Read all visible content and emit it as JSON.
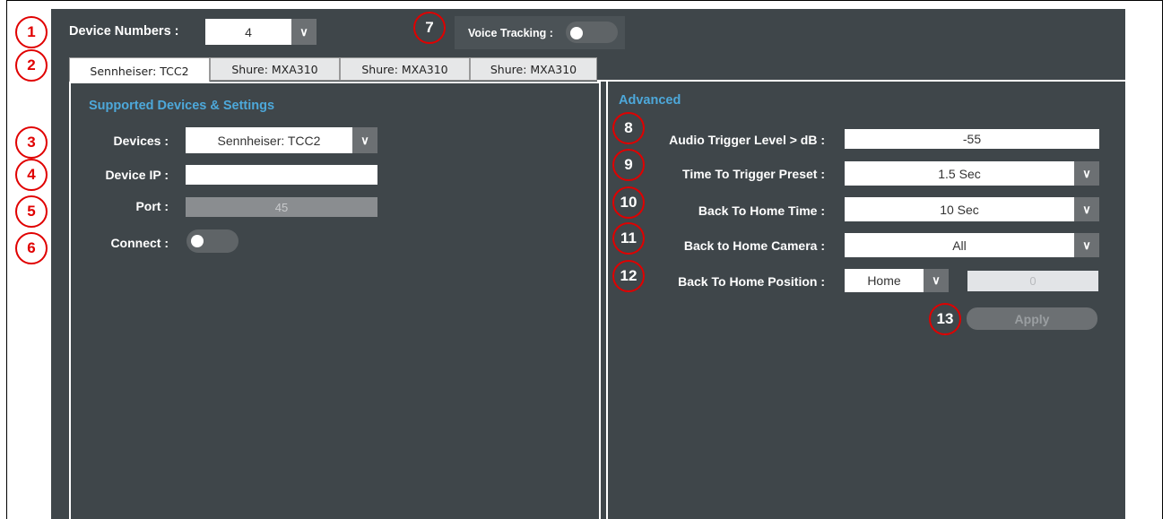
{
  "top": {
    "device_numbers_label": "Device Numbers :",
    "device_numbers_value": "4",
    "voice_tracking_label": "Voice Tracking :"
  },
  "tabs": [
    {
      "label": "Sennheiser: TCC2",
      "active": true
    },
    {
      "label": "Shure: MXA310",
      "active": false
    },
    {
      "label": "Shure: MXA310",
      "active": false
    },
    {
      "label": "Shure: MXA310",
      "active": false
    }
  ],
  "left_panel": {
    "title": "Supported Devices & Settings",
    "devices_label": "Devices :",
    "devices_value": "Sennheiser: TCC2",
    "device_ip_label": "Device IP :",
    "device_ip_value": "",
    "port_label": "Port :",
    "port_value": "45",
    "connect_label": "Connect :"
  },
  "right_panel": {
    "title": "Advanced",
    "audio_trigger_label": "Audio Trigger Level > dB :",
    "audio_trigger_value": "-55",
    "time_to_trigger_label": "Time To Trigger Preset :",
    "time_to_trigger_value": "1.5 Sec",
    "back_home_time_label": "Back To Home Time :",
    "back_home_time_value": "10 Sec",
    "back_home_camera_label": "Back to Home Camera :",
    "back_home_camera_value": "All",
    "back_home_position_label": "Back To Home Position :",
    "back_home_position_value": "Home",
    "back_home_position_number": "0",
    "apply_label": "Apply"
  },
  "annotations": [
    "1",
    "2",
    "3",
    "4",
    "5",
    "6",
    "7",
    "8",
    "9",
    "10",
    "11",
    "12",
    "13"
  ],
  "colors": {
    "panel_bg": "#3f464a",
    "accent_title": "#4da8da",
    "annotation_red": "#e00000"
  }
}
